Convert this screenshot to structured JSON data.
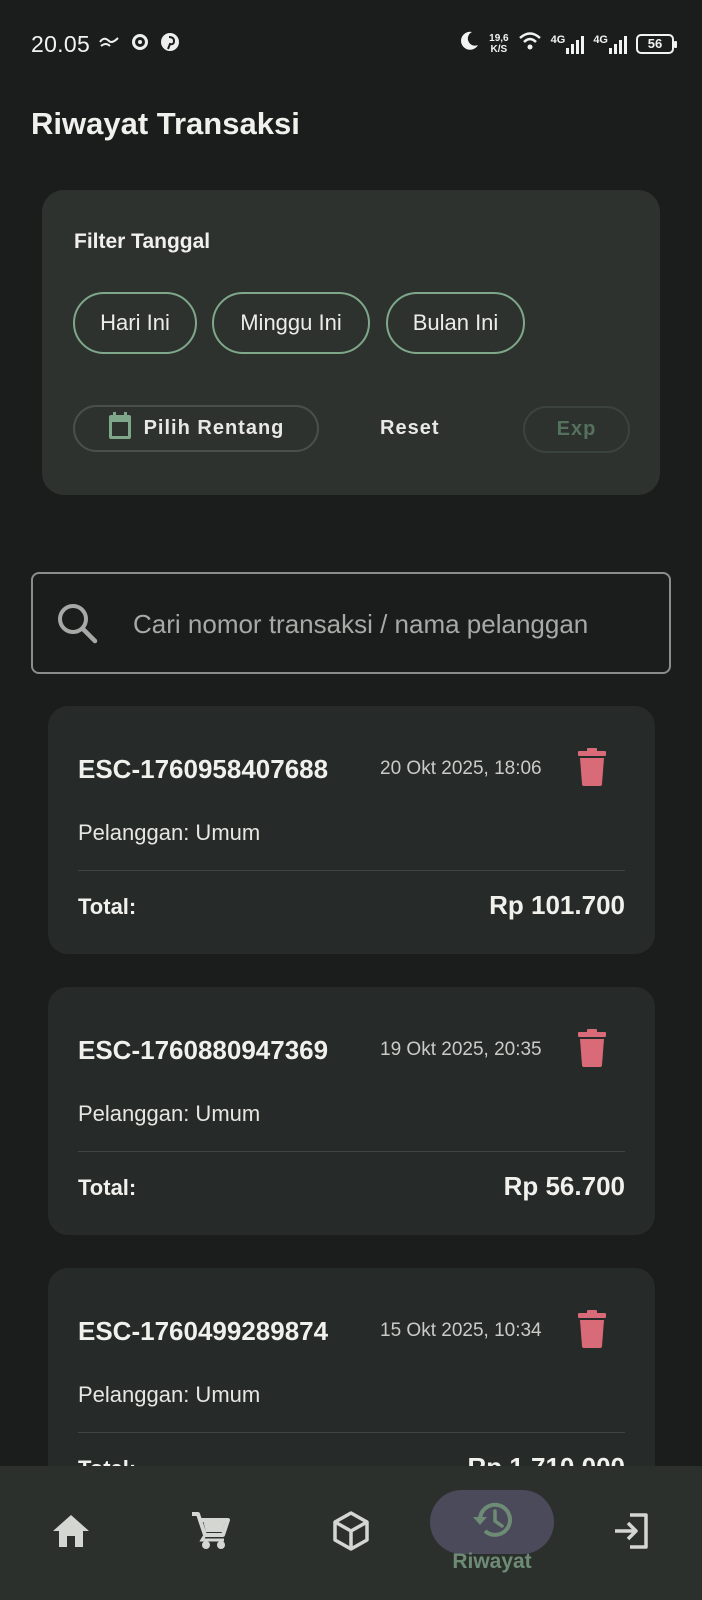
{
  "status_bar": {
    "time": "20.05",
    "net_speed_value": "19,6",
    "net_speed_unit": "K/S",
    "signal1_label": "4G",
    "signal2_label": "4G",
    "battery": "56",
    "icons": [
      "notification-icon",
      "sync-icon",
      "pinterest-icon",
      "moon-icon",
      "wifi-icon",
      "signal-icon",
      "battery-icon"
    ]
  },
  "page": {
    "title": "Riwayat Transaksi"
  },
  "filter": {
    "title": "Filter Tanggal",
    "chips": [
      {
        "label": "Hari Ini"
      },
      {
        "label": "Minggu Ini"
      },
      {
        "label": "Bulan Ini"
      }
    ],
    "range_label": "Pilih Rentang",
    "reset_label": "Reset",
    "export_label": "Exp"
  },
  "search": {
    "placeholder": "Cari nomor transaksi / nama pelanggan",
    "value": ""
  },
  "transactions": [
    {
      "id": "ESC-1760958407688",
      "date": "20 Okt 2025, 18:06",
      "customer": "Pelanggan: Umum",
      "total_label": "Total:",
      "total": "Rp 101.700"
    },
    {
      "id": "ESC-1760880947369",
      "date": "19 Okt 2025, 20:35",
      "customer": "Pelanggan: Umum",
      "total_label": "Total:",
      "total": "Rp 56.700"
    },
    {
      "id": "ESC-1760499289874",
      "date": "15 Okt 2025, 10:34",
      "customer": "Pelanggan: Umum",
      "total_label": "Total:",
      "total": "Rp 1.710.000"
    }
  ],
  "nav": {
    "items": [
      {
        "icon": "home-icon"
      },
      {
        "icon": "cart-icon"
      },
      {
        "icon": "box-icon"
      },
      {
        "icon": "history-icon",
        "label": "Riwayat",
        "active": true
      },
      {
        "icon": "logout-icon"
      }
    ]
  },
  "colors": {
    "background": "#1b1d1c",
    "card": "#2d322f",
    "chip_border": "#7fa88a",
    "delete": "#d96b78",
    "nav_active_pill": "#4a4a5a",
    "nav_active_label": "#6e8b76"
  }
}
